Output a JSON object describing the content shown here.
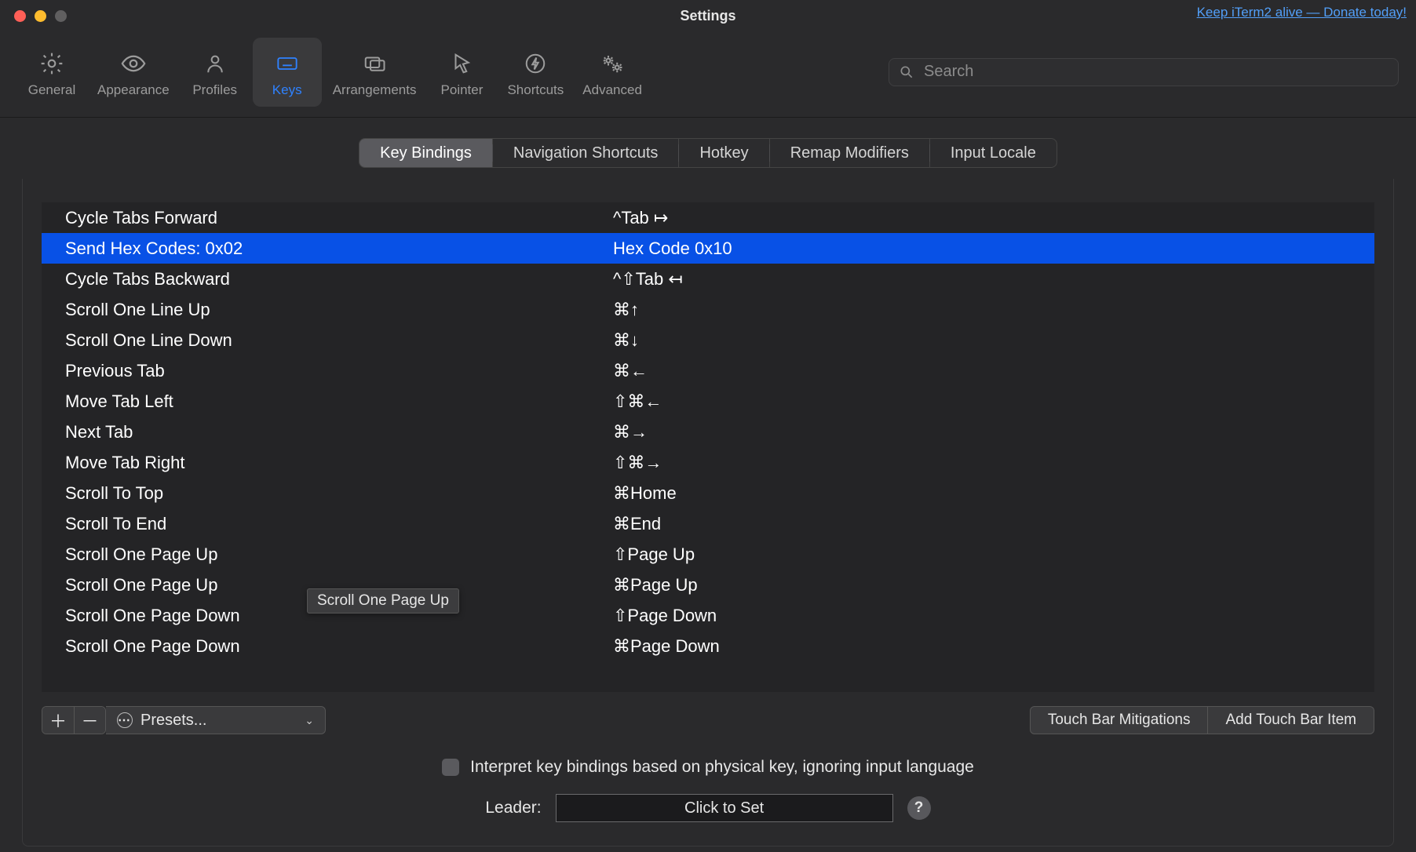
{
  "window_title": "Settings",
  "donate_link": "Keep iTerm2 alive — Donate today!",
  "search_placeholder": "Search",
  "toolbar": [
    {
      "id": "general",
      "label": "General",
      "icon": "gear-icon",
      "active": false
    },
    {
      "id": "appearance",
      "label": "Appearance",
      "icon": "eye-icon",
      "active": false
    },
    {
      "id": "profiles",
      "label": "Profiles",
      "icon": "person-icon",
      "active": false
    },
    {
      "id": "keys",
      "label": "Keys",
      "icon": "keyboard-icon",
      "active": true
    },
    {
      "id": "arrangements",
      "label": "Arrangements",
      "icon": "windows-icon",
      "active": false
    },
    {
      "id": "pointer",
      "label": "Pointer",
      "icon": "pointer-icon",
      "active": false
    },
    {
      "id": "shortcuts",
      "label": "Shortcuts",
      "icon": "bolt-icon",
      "active": false
    },
    {
      "id": "advanced",
      "label": "Advanced",
      "icon": "gears-icon",
      "active": false
    }
  ],
  "tabs": [
    {
      "label": "Key Bindings",
      "selected": true
    },
    {
      "label": "Navigation Shortcuts",
      "selected": false
    },
    {
      "label": "Hotkey",
      "selected": false
    },
    {
      "label": "Remap Modifiers",
      "selected": false
    },
    {
      "label": "Input Locale",
      "selected": false
    }
  ],
  "bindings": [
    {
      "action": "Cycle Tabs Forward",
      "shortcut": "^Tab ↦",
      "selected": false
    },
    {
      "action": "Send Hex Codes: 0x02",
      "shortcut": "Hex Code 0x10",
      "selected": true
    },
    {
      "action": "Cycle Tabs Backward",
      "shortcut": "^⇧Tab ↤",
      "selected": false
    },
    {
      "action": "Scroll One Line Up",
      "shortcut": "⌘↑",
      "selected": false
    },
    {
      "action": "Scroll One Line Down",
      "shortcut": "⌘↓",
      "selected": false
    },
    {
      "action": "Previous Tab",
      "shortcut": "⌘←",
      "selected": false
    },
    {
      "action": "Move Tab Left",
      "shortcut": "⇧⌘←",
      "selected": false
    },
    {
      "action": "Next Tab",
      "shortcut": "⌘→",
      "selected": false
    },
    {
      "action": "Move Tab Right",
      "shortcut": "⇧⌘→",
      "selected": false
    },
    {
      "action": "Scroll To Top",
      "shortcut": "⌘Home",
      "selected": false
    },
    {
      "action": "Scroll To End",
      "shortcut": "⌘End",
      "selected": false
    },
    {
      "action": "Scroll One Page Up",
      "shortcut": "⇧Page Up",
      "selected": false
    },
    {
      "action": "Scroll One Page Up",
      "shortcut": "⌘Page Up",
      "selected": false
    },
    {
      "action": "Scroll One Page Down",
      "shortcut": "⇧Page Down",
      "selected": false
    },
    {
      "action": "Scroll One Page Down",
      "shortcut": "⌘Page Down",
      "selected": false
    }
  ],
  "tooltip_text": "Scroll One Page Up",
  "presets_label": "Presets...",
  "touchbar_mitigations_label": "Touch Bar Mitigations",
  "add_touchbar_label": "Add Touch Bar Item",
  "checkbox_label": "Interpret key bindings based on physical key, ignoring input language",
  "leader_label": "Leader:",
  "leader_button_label": "Click to Set"
}
